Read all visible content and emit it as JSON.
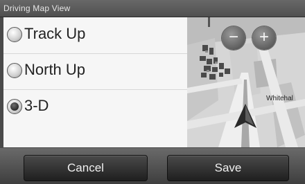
{
  "header": {
    "title": "Driving Map View"
  },
  "options": [
    {
      "label": "Track Up",
      "selected": false
    },
    {
      "label": "North Up",
      "selected": false
    },
    {
      "label": "3-D",
      "selected": true
    }
  ],
  "map": {
    "zoom_out_label": "−",
    "zoom_in_label": "+",
    "street_label": "Whitehal"
  },
  "buttons": {
    "cancel_label": "Cancel",
    "save_label": "Save"
  }
}
